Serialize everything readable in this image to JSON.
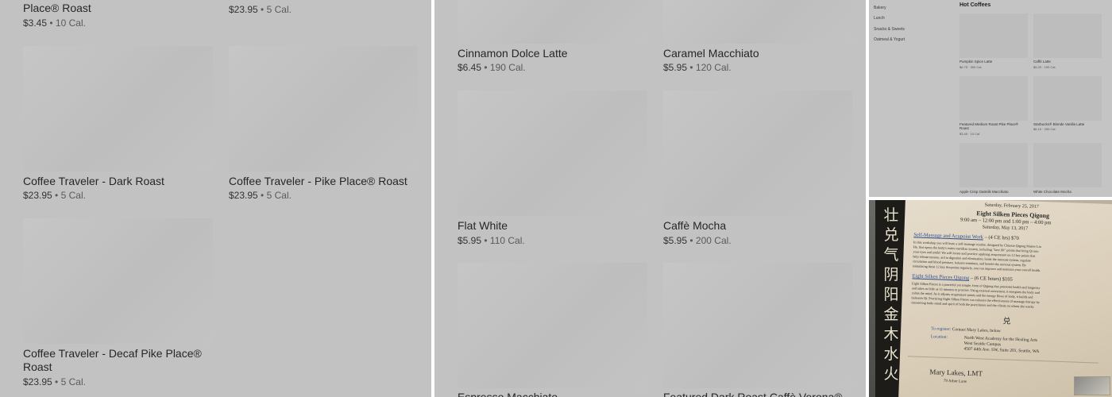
{
  "left_panel": {
    "items": [
      {
        "name": "Place® Roast",
        "price": "$3.45",
        "cal": "10 Cal."
      },
      {
        "name": "",
        "price": "$23.95",
        "cal": "5 Cal."
      },
      {
        "name": "Coffee Traveler - Dark Roast",
        "price": "$23.95",
        "cal": "5 Cal."
      },
      {
        "name": "Coffee Traveler - Pike Place® Roast",
        "price": "$23.95",
        "cal": "5 Cal."
      },
      {
        "name_line1": "Coffee Traveler - Decaf Pike Place®",
        "name_line2": "Roast",
        "price": "$23.95",
        "cal": "5 Cal."
      }
    ],
    "separator": "•"
  },
  "mid_panel": {
    "items": [
      {
        "name": "Cinnamon Dolce Latte",
        "price": "$6.45",
        "cal": "190 Cal."
      },
      {
        "name": "Caramel Macchiato",
        "price": "$5.95",
        "cal": "120 Cal."
      },
      {
        "name": "Flat White",
        "price": "$5.95",
        "cal": "110 Cal."
      },
      {
        "name": "Caffè Mocha",
        "price": "$5.95",
        "cal": "200 Cal."
      },
      {
        "name": "Espresso Macchiato",
        "price": "",
        "cal": ""
      },
      {
        "name": "Featured Dark Roast Caffè Verona®",
        "price": "",
        "cal": ""
      }
    ],
    "separator": "•"
  },
  "mini_panel": {
    "sidebar": [
      "Bakery",
      "Lunch",
      "Snacks & Sweets",
      "Oatmeal & Yogurt"
    ],
    "section_title": "Hot Coffees",
    "items": [
      {
        "name": "Pumpkin Spice Latte",
        "meta": "$6.75 · 390 Cal."
      },
      {
        "name": "Caffè Latte",
        "meta": "$5.25 · 190 Cal."
      },
      {
        "name": "Featured Medium Roast Pike Place® Roast",
        "meta": "$3.45 · 10 Cal."
      },
      {
        "name": "Starbucks® Blonde Vanilla Latte",
        "meta": "$6.15 · 250 Cal."
      },
      {
        "name": "Apple Crisp Oatmilk Macchiato",
        "meta": ""
      },
      {
        "name": "White Chocolate Mocha",
        "meta": ""
      }
    ]
  },
  "flyer": {
    "chars": [
      "壮",
      "兑",
      "气",
      "阴",
      "阳",
      "金",
      "木",
      "水",
      "火"
    ],
    "date1": "Saturday, February 25, 2017",
    "title": "Eight Silken Pieces Qigong",
    "times": "9:00 am – 12:00 pm  and  1:00 pm – 4:00 pm",
    "date2": "Saturday, May 13, 2017",
    "section1_title": "Self-Massage and Acupoint Work",
    "section1_suffix": " – (4 CE hrs) $70",
    "section1_lines": [
      "In this workshop you will learn a self-massage routine, designed by Chinese Qigong Master Liu",
      "He, that opens the body's entire meridian system, including \"face lift\" points that bring Qi into",
      "your eyes and smile! We will locate and practice applying acupressure on 12 key points that",
      "help release tension, aid in digestion and elimination, boost the immune system, regulate",
      "circulation and blood pressure, balance emotions, and benefit the nervous system. By",
      "stimulating these 12 key Acupoints regularly, you can improve and maintain your overall health."
    ],
    "section2_title": "Eight Silken Pieces Qigong",
    "section2_suffix": " – (6 CE hours) $105",
    "section2_lines": [
      "Eight Silken Pieces is a powerful yet simple, form of Qigong that promotes health and longevity",
      "and takes as little as 15 minutes to practice. Using external movement, it energizes the body and",
      "calms the mind. As it adjusts acupressure points and the energy flows of body, it builds and",
      "balances Qi. Practicing Eight Silken Pieces can enhance the effectiveness of massage therapy by",
      "connecting body-mind and spirit of both the practitioner and the clients on whom she works."
    ],
    "symbol": "兑",
    "register_label": "To register:",
    "register_text": "Contact Mary Lakes, below",
    "location_label": "Location:",
    "location_lines": [
      "North West Academy for the Healing Arts",
      "West Seattle Campus",
      "4507 44th Ave. SW, Suite 201, Seattle, WA"
    ],
    "contact_name": "Mary Lakes, LMT",
    "contact_line": "79 Arbor Lane"
  }
}
